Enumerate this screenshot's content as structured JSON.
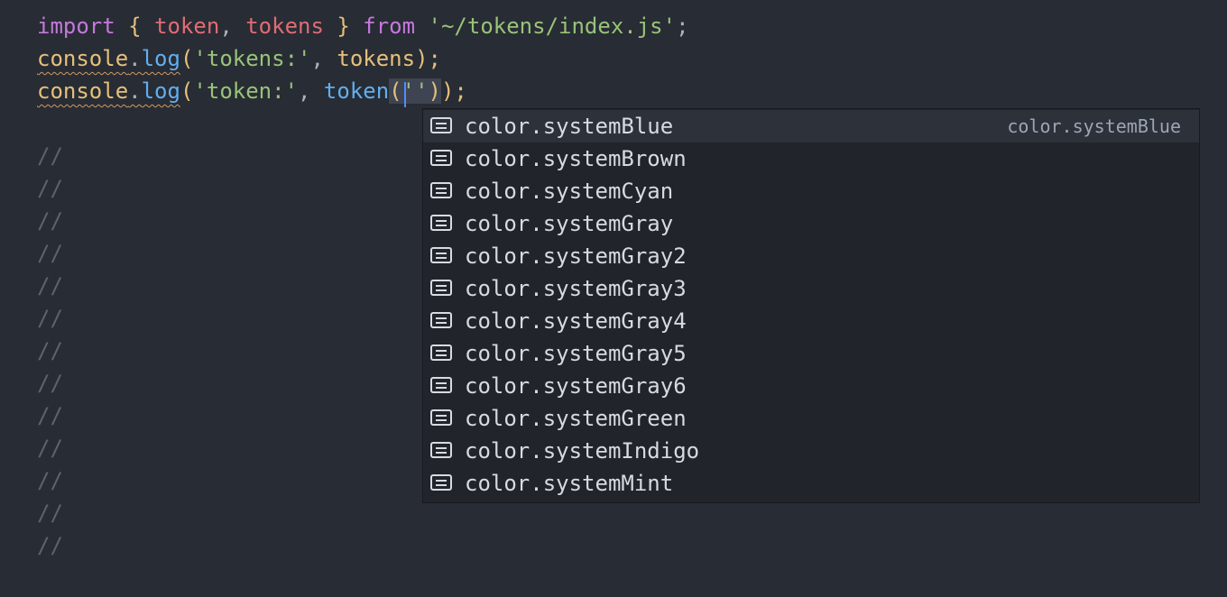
{
  "code": {
    "line1": {
      "import_kw": "import",
      "lbrace": "{",
      "token_var": "token",
      "comma": ",",
      "tokens_var": "tokens",
      "rbrace": "}",
      "from_kw": "from",
      "module_path": "'~/tokens/index.js'",
      "semicolon": ";"
    },
    "line2": {
      "console": "console",
      "dot": ".",
      "log": "log",
      "open_paren": "(",
      "string": "'tokens:'",
      "comma": ", ",
      "arg": "tokens",
      "close": ");"
    },
    "line3": {
      "console": "console",
      "dot": ".",
      "log": "log",
      "open_paren": "(",
      "string": "'token:'",
      "comma": ", ",
      "fn": "token",
      "inner_open": "(",
      "quote_open": "'",
      "quote_close": "'",
      "inner_close": ")",
      "close": ");"
    },
    "comment_marker": "//"
  },
  "suggestions": {
    "selected_detail": "color.systemBlue",
    "items": [
      "color.systemBlue",
      "color.systemBrown",
      "color.systemCyan",
      "color.systemGray",
      "color.systemGray2",
      "color.systemGray3",
      "color.systemGray4",
      "color.systemGray5",
      "color.systemGray6",
      "color.systemGreen",
      "color.systemIndigo",
      "color.systemMint"
    ]
  },
  "colors": {
    "background": "#282c34",
    "keyword": "#c678dd",
    "string": "#98c379",
    "variable": "#e06c75",
    "function": "#61afef",
    "object": "#e5c07b",
    "comment": "#5c6370",
    "cursor": "#528bff"
  }
}
